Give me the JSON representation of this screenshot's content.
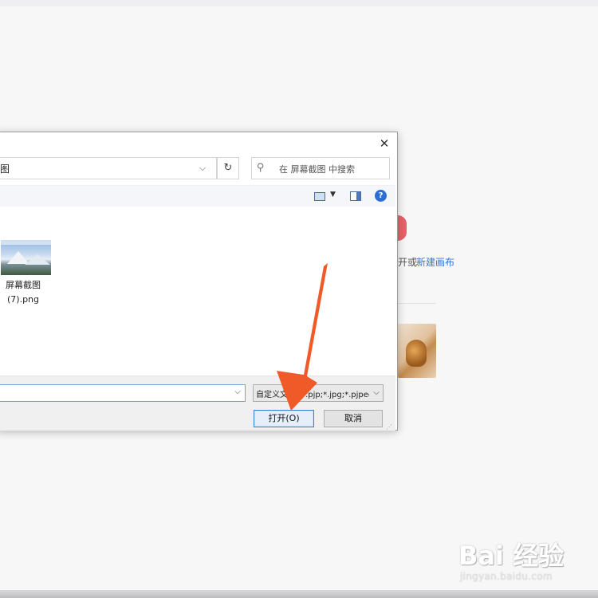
{
  "background": {
    "partial_text": "开或",
    "new_canvas_link": "新建画布"
  },
  "dialog": {
    "close_glyph": "✕",
    "address": {
      "partial_text": "图",
      "dropdown_glyph": "⌵"
    },
    "refresh_glyph": "↻",
    "search": {
      "icon_glyph": "⚲",
      "placeholder": "在 屏幕截图 中搜索"
    },
    "toolbar": {
      "view_dropdown_glyph": "▼",
      "help_glyph": "?"
    },
    "file": {
      "name_line1": "屏幕截图",
      "name_line2": "(7).png"
    },
    "filename_input_value": "",
    "filename_dropdown_glyph": "⌵",
    "filter": {
      "value": "自定义文件 (*.pjp;*.jpg;*.pjpeg",
      "dropdown_glyph": "⌵"
    },
    "open_label": "打开(O)",
    "cancel_label": "取消",
    "grip_glyph": "⋰"
  },
  "annotation": {
    "arrow_color": "#f05a28"
  },
  "watermark": {
    "logo_text": "Bai 经验",
    "url_text": "jingyan.baidu.com"
  }
}
